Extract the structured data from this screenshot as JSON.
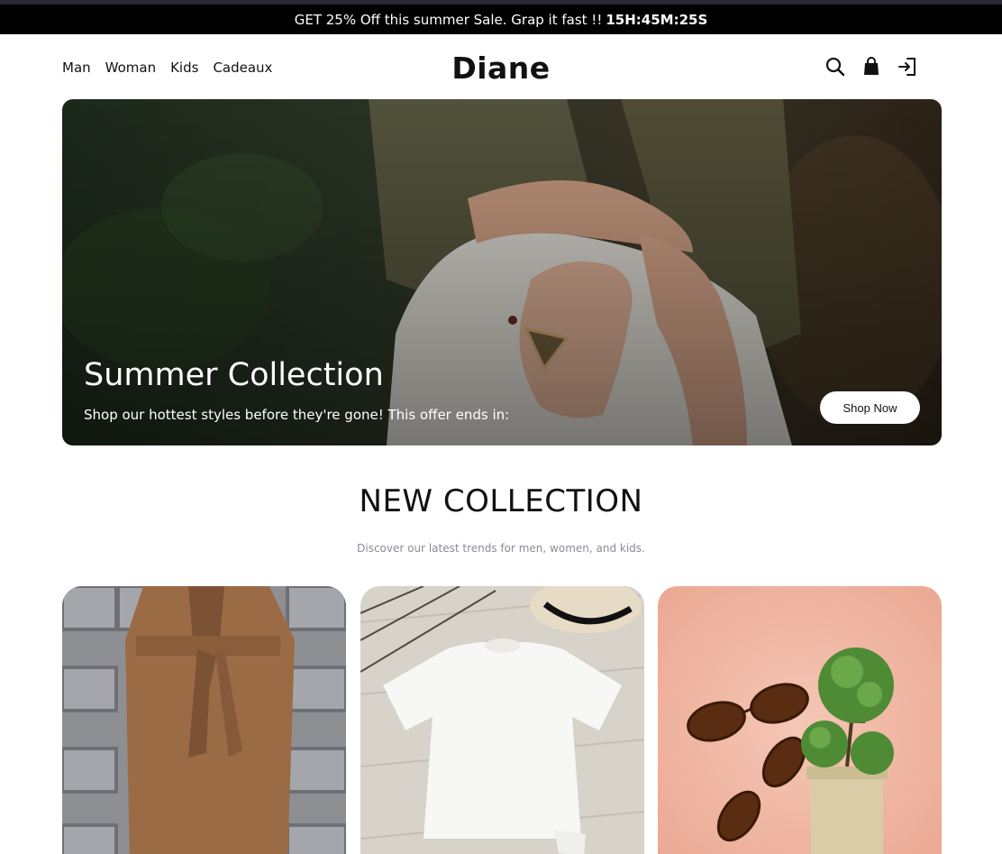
{
  "promo": {
    "text": "GET 25% Off this summer Sale. Grap it fast !!",
    "timer": "15H:45M:25S"
  },
  "nav": {
    "items": [
      "Man",
      "Woman",
      "Kids",
      "Cadeaux"
    ]
  },
  "brand": {
    "name": "Diane"
  },
  "header_icons": [
    "search-icon",
    "shopping-bag-icon",
    "login-icon"
  ],
  "hero": {
    "title": "Summer Collection",
    "subtitle": "Shop our hottest styles before they're gone! This offer ends in:",
    "button_label": "Shop Now"
  },
  "collection": {
    "title": "NEW COLLECTION",
    "subtitle": "Discover our latest trends for men, women, and kids.",
    "cards": [
      "brown-wrap-coat",
      "white-t-shirt",
      "tortoise-sunglasses"
    ]
  },
  "colors": {
    "promo_bg": "#000000",
    "text": "#111111",
    "muted": "#8b8b96",
    "card3_bg": "#f0b9a6"
  }
}
